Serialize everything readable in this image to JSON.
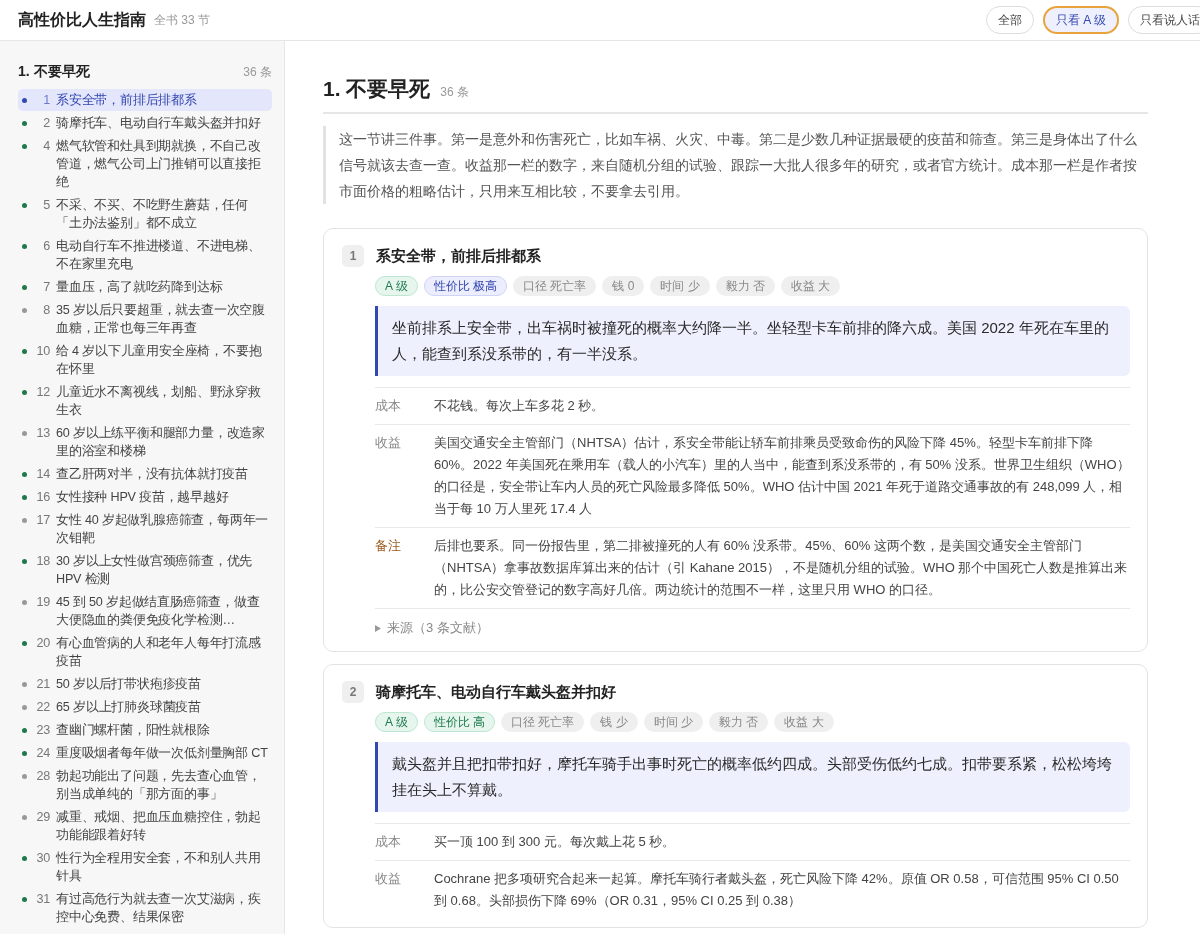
{
  "header": {
    "title": "高性价比人生指南",
    "subtitle": "全书 33 节",
    "filters": [
      {
        "label": "全部",
        "selected": false
      },
      {
        "label": "只看 A 级",
        "selected": true
      },
      {
        "label": "只看说人话",
        "selected": false
      }
    ]
  },
  "sidebar": {
    "section": {
      "title": "1. 不要早死",
      "count": "36 条"
    },
    "items": [
      {
        "number": "1",
        "text": "系安全带，前排后排都系",
        "color": "#3347b0",
        "selected": true
      },
      {
        "number": "2",
        "text": "骑摩托车、电动自行车戴头盔并扣好",
        "color": "#1e7a4a",
        "selected": false
      },
      {
        "number": "4",
        "text": "燃气软管和灶具到期就换，不自己改管道，燃气公司上门推销可以直接拒绝",
        "color": "#1e7a4a",
        "selected": false
      },
      {
        "number": "5",
        "text": "不采、不买、不吃野生蘑菇，任何「土办法鉴别」都不成立",
        "color": "#1e7a4a",
        "selected": false
      },
      {
        "number": "6",
        "text": "电动自行车不推进楼道、不进电梯、不在家里充电",
        "color": "#1e7a4a",
        "selected": false
      },
      {
        "number": "7",
        "text": "量血压，高了就吃药降到达标",
        "color": "#1e7a4a",
        "selected": false
      },
      {
        "number": "8",
        "text": "35 岁以后只要超重，就去查一次空腹血糖，正常也每三年再查",
        "color": "#999999",
        "selected": false
      },
      {
        "number": "10",
        "text": "给 4 岁以下儿童用安全座椅，不要抱在怀里",
        "color": "#1e7a4a",
        "selected": false
      },
      {
        "number": "12",
        "text": "儿童近水不离视线，划船、野泳穿救生衣",
        "color": "#1e7a4a",
        "selected": false
      },
      {
        "number": "13",
        "text": "60 岁以上练平衡和腿部力量，改造家里的浴室和楼梯",
        "color": "#999999",
        "selected": false
      },
      {
        "number": "14",
        "text": "查乙肝两对半，没有抗体就打疫苗",
        "color": "#1e7a4a",
        "selected": false
      },
      {
        "number": "16",
        "text": "女性接种 HPV 疫苗，越早越好",
        "color": "#1e7a4a",
        "selected": false
      },
      {
        "number": "17",
        "text": "女性 40 岁起做乳腺癌筛查，每两年一次钼靶",
        "color": "#999999",
        "selected": false
      },
      {
        "number": "18",
        "text": "30 岁以上女性做宫颈癌筛查，优先 HPV 检测",
        "color": "#1e7a4a",
        "selected": false
      },
      {
        "number": "19",
        "text": "45 到 50 岁起做结直肠癌筛查，做查大便隐血的粪便免疫化学检测…",
        "color": "#999999",
        "selected": false
      },
      {
        "number": "20",
        "text": "有心血管病的人和老年人每年打流感疫苗",
        "color": "#1e7a4a",
        "selected": false
      },
      {
        "number": "21",
        "text": "50 岁以后打带状疱疹疫苗",
        "color": "#999999",
        "selected": false
      },
      {
        "number": "22",
        "text": "65 岁以上打肺炎球菌疫苗",
        "color": "#999999",
        "selected": false
      },
      {
        "number": "23",
        "text": "查幽门螺杆菌，阳性就根除",
        "color": "#1e7a4a",
        "selected": false
      },
      {
        "number": "24",
        "text": "重度吸烟者每年做一次低剂量胸部 CT",
        "color": "#1e7a4a",
        "selected": false
      },
      {
        "number": "28",
        "text": "勃起功能出了问题，先去查心血管，别当成单纯的「那方面的事」",
        "color": "#999999",
        "selected": false
      },
      {
        "number": "29",
        "text": "减重、戒烟、把血压血糖控住，勃起功能能跟着好转",
        "color": "#999999",
        "selected": false
      },
      {
        "number": "30",
        "text": "性行为全程用安全套，不和别人共用针具",
        "color": "#1e7a4a",
        "selected": false
      },
      {
        "number": "31",
        "text": "有过高危行为就去查一次艾滋病，疾控中心免费、结果保密",
        "color": "#1e7a4a",
        "selected": false
      }
    ]
  },
  "main": {
    "title": "1. 不要早死",
    "count": "36 条",
    "intro": "这一节讲三件事。第一是意外和伤害死亡，比如车祸、火灾、中毒。第二是少数几种证据最硬的疫苗和筛查。第三是身体出了什么信号就该去查一查。收益那一栏的数字，来自随机分组的试验、跟踪一大批人很多年的研究，或者官方统计。成本那一栏是作者按市面价格的粗略估计，只用来互相比较，不要拿去引用。",
    "cards": [
      {
        "number": "1",
        "title": "系安全带，前排后排都系",
        "tags": [
          {
            "label": "A 级",
            "kind": "grade"
          },
          {
            "label": "性价比 极高",
            "kind": "top"
          },
          {
            "label": "口径 死亡率",
            "kind": "plain"
          },
          {
            "label": "钱 0",
            "kind": "plain"
          },
          {
            "label": "时间 少",
            "kind": "plain"
          },
          {
            "label": "毅力 否",
            "kind": "plain"
          },
          {
            "label": "收益 大",
            "kind": "plain"
          }
        ],
        "summary": "坐前排系上安全带，出车祸时被撞死的概率大约降一半。坐轻型卡车前排的降六成。美国 2022 年死在车里的人，能查到系没系带的，有一半没系。",
        "rows": [
          {
            "label": "成本",
            "kind": "cost",
            "text": "不花钱。每次上车多花 2 秒。"
          },
          {
            "label": "收益",
            "kind": "benefit",
            "text": "美国交通安全主管部门（NHTSA）估计，系安全带能让轿车前排乘员受致命伤的风险下降 45%。轻型卡车前排下降 60%。2022 年美国死在乘用车（载人的小汽车）里的人当中，能查到系没系带的，有 50% 没系。世界卫生组织（WHO）的口径是，安全带让车内人员的死亡风险最多降低 50%。WHO 估计中国 2021 年死于道路交通事故的有 248,099 人，相当于每 10 万人里死 17.4 人"
          },
          {
            "label": "备注",
            "kind": "note",
            "text": "后排也要系。同一份报告里，第二排被撞死的人有 60% 没系带。45%、60% 这两个数，是美国交通安全主管部门（NHTSA）拿事故数据库算出来的估计（引 Kahane 2015），不是随机分组的试验。WHO 那个中国死亡人数是推算出来的，比公安交管登记的数字高好几倍。两边统计的范围不一样，这里只用 WHO 的口径。"
          }
        ],
        "sources": "来源（3 条文献）"
      },
      {
        "number": "2",
        "title": "骑摩托车、电动自行车戴头盔并扣好",
        "tags": [
          {
            "label": "A 级",
            "kind": "grade"
          },
          {
            "label": "性价比 高",
            "kind": "high"
          },
          {
            "label": "口径 死亡率",
            "kind": "plain"
          },
          {
            "label": "钱 少",
            "kind": "plain"
          },
          {
            "label": "时间 少",
            "kind": "plain"
          },
          {
            "label": "毅力 否",
            "kind": "plain"
          },
          {
            "label": "收益 大",
            "kind": "plain"
          }
        ],
        "summary": "戴头盔并且把扣带扣好，摩托车骑手出事时死亡的概率低约四成。头部受伤低约七成。扣带要系紧，松松垮垮挂在头上不算戴。",
        "rows": [
          {
            "label": "成本",
            "kind": "cost",
            "text": "买一顶 100 到 300 元。每次戴上花 5 秒。"
          },
          {
            "label": "收益",
            "kind": "benefit",
            "text": "Cochrane 把多项研究合起来一起算。摩托车骑行者戴头盔，死亡风险下降 42%。原值 OR 0.58，可信范围 95% CI 0.50 到 0.68。头部损伤下降 69%（OR 0.31，95% CI 0.25 到 0.38）"
          }
        ]
      }
    ]
  }
}
